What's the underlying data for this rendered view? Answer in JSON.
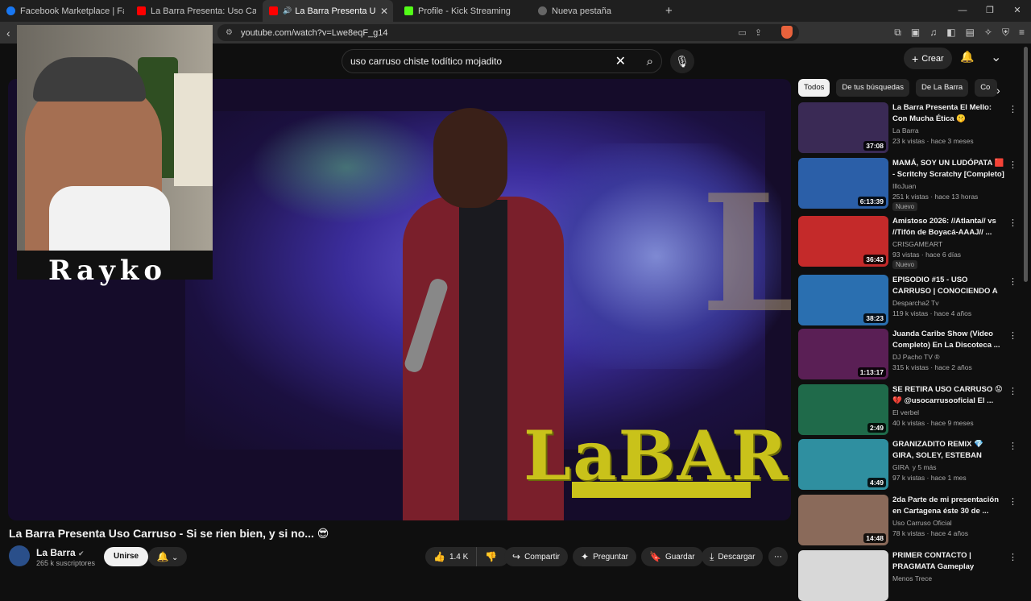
{
  "browser": {
    "tabs": [
      {
        "label": "Facebook Marketplace | Facebook",
        "color": "#1877f2"
      },
      {
        "label": "La Barra Presenta: Uso Carruso - El M",
        "color": "#ff0000"
      },
      {
        "label": "La Barra Presenta Uso Carrus",
        "color": "#ff0000"
      },
      {
        "label": "Profile - Kick Streaming",
        "color": "#53fc18"
      },
      {
        "label": "Nueva pestaña",
        "color": "#888888"
      }
    ],
    "new_tab": "+",
    "url": "youtube.com/watch?v=Lwe8eqF_g14"
  },
  "youtube": {
    "search_value": "uso carruso chiste todítico mojadito",
    "create_label": "Crear"
  },
  "webcam": {
    "overlay_name": "Rayko"
  },
  "video_overlay": {
    "logo_text": "LaBARRA",
    "bg_letter": "La"
  },
  "video": {
    "title": "La Barra Presenta Uso Carruso - Si se rien bien, y si no... 😎",
    "channel": "La Barra",
    "subscribers": "265 k suscriptores",
    "join_label": "Unirse",
    "likes": "1.4 K",
    "share_label": "Compartir",
    "ask_label": "Preguntar",
    "save_label": "Guardar",
    "download_label": "Descargar"
  },
  "chips": [
    "Todos",
    "De tus búsquedas",
    "De La Barra",
    "Co"
  ],
  "recommendations": [
    {
      "title": "La Barra Presenta El Mello: Con Mucha Ética 🤫",
      "channel": "La Barra",
      "meta": "23 k vistas · hace 3 meses",
      "duration": "37:08",
      "badge": "",
      "thumb": "#3a2a55"
    },
    {
      "title": "MAMÁ, SOY UN LUDÓPATA 🟥 - Scritchy Scratchy [Completo]",
      "channel": "IlloJuan",
      "meta": "251 k vistas · hace 13 horas",
      "duration": "6:13:39",
      "badge": "Nuevo",
      "thumb": "#2b5fa8"
    },
    {
      "title": "Amistoso 2026: //Atlanta// vs //Tifón de Boyacá-AAAJ// ...",
      "channel": "CRISGAMEART",
      "meta": "93 vistas · hace 6 días",
      "duration": "36:43",
      "badge": "Nuevo",
      "thumb": "#c42a2a"
    },
    {
      "title": "EPISODIO #15 - USO CARRUSO | CONOCIENDO A EDGAR ...",
      "channel": "Desparcha2 Tv",
      "meta": "119 k vistas · hace 4 años",
      "duration": "38:23",
      "badge": "",
      "thumb": "#2a6fb0"
    },
    {
      "title": "Juanda Caribe Show (Video Completo) En La Discoteca ...",
      "channel": "DJ Pacho TV ®",
      "meta": "315 k vistas · hace 2 años",
      "duration": "1:13:17",
      "badge": "",
      "thumb": "#5a1f55"
    },
    {
      "title": "SE RETIRA USO CARRUSO 😟 💔 @usocarrusooficial El ...",
      "channel": "El verbel",
      "meta": "40 k vistas · hace 9 meses",
      "duration": "2:49",
      "badge": "",
      "thumb": "#1f6a4a"
    },
    {
      "title": "GRANIZADITO REMIX 💎 GIRA, SOLEY, ESTEBAN ROJAS, DH, ...",
      "channel": "GIRA",
      "meta": "97 k vistas · hace 1 mes",
      "duration": "4:49",
      "badge": "",
      "channel_extra": "y 5 más",
      "thumb": "#2f8fa0"
    },
    {
      "title": "2da Parte de mi presentación en Cartagena éste 30 de ...",
      "channel": "Uso Carruso Oficial",
      "meta": "78 k vistas · hace 4 años",
      "duration": "14:48",
      "badge": "",
      "thumb": "#8a6a5a"
    },
    {
      "title": "PRIMER CONTACTO | PRAGMATA Gameplay Español",
      "channel": "Menos Trece",
      "meta": "",
      "duration": "",
      "badge": "",
      "thumb": "#d8d8d8"
    }
  ]
}
